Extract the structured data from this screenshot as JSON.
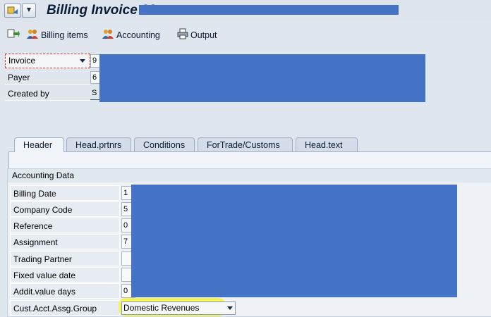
{
  "window": {
    "title": "Billing Invoice 93"
  },
  "toolbar": {
    "billing_items": "Billing items",
    "accounting": "Accounting",
    "output": "Output"
  },
  "header_fields": {
    "document_type_select": "Invoice",
    "document_value_prefix": "9",
    "payer_label": "Payer",
    "payer_value_prefix": "6",
    "created_by_label": "Created by",
    "created_by_value_prefix": "S"
  },
  "tabs": [
    {
      "label": "Header",
      "active": true
    },
    {
      "label": "Head.prtnrs",
      "active": false
    },
    {
      "label": "Conditions",
      "active": false
    },
    {
      "label": "ForTrade/Customs",
      "active": false
    },
    {
      "label": "Head.text",
      "active": false
    }
  ],
  "accounting_data": {
    "group_title": "Accounting Data",
    "fields": [
      {
        "label": "Billing Date",
        "value_prefix": "1"
      },
      {
        "label": "Company Code",
        "value_prefix": "5"
      },
      {
        "label": "Reference",
        "value_prefix": "0"
      },
      {
        "label": "Assignment",
        "value_prefix": "7"
      },
      {
        "label": "Trading Partner",
        "value_prefix": ""
      },
      {
        "label": "Fixed value date",
        "value_prefix": ""
      },
      {
        "label": "Addit.value days",
        "value_prefix": "0"
      }
    ],
    "cust_acct_label": "Cust.Acct.Assg.Group",
    "cust_acct_value": "Domestic Revenues"
  },
  "colors": {
    "redaction": "#4472c4",
    "highlight": "#f3f34a",
    "accent": "#0c1d3a"
  }
}
